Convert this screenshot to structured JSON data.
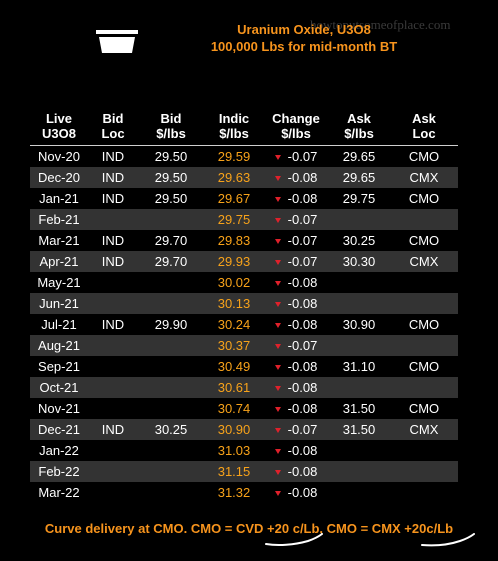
{
  "header": {
    "watermark": "howtoputsomeofplace.com",
    "title_line1": "Uranium Oxide, U3O8",
    "title_line2": "100,000 Lbs for mid-month BT"
  },
  "columns": [
    "Live\nU3O8",
    "Bid\nLoc",
    "Bid\n$/lbs",
    "Indic\n$/lbs",
    "Change\n$/lbs",
    "Ask\n$/lbs",
    "Ask\nLoc"
  ],
  "rows": [
    {
      "month": "Nov-20",
      "bid_loc": "IND",
      "bid": "29.50",
      "indic": "29.59",
      "change": "-0.07",
      "ask": "29.65",
      "ask_loc": "CMO"
    },
    {
      "month": "Dec-20",
      "bid_loc": "IND",
      "bid": "29.50",
      "indic": "29.63",
      "change": "-0.08",
      "ask": "29.65",
      "ask_loc": "CMX"
    },
    {
      "month": "Jan-21",
      "bid_loc": "IND",
      "bid": "29.50",
      "indic": "29.67",
      "change": "-0.08",
      "ask": "29.75",
      "ask_loc": "CMO"
    },
    {
      "month": "Feb-21",
      "bid_loc": "",
      "bid": "",
      "indic": "29.75",
      "change": "-0.07",
      "ask": "",
      "ask_loc": ""
    },
    {
      "month": "Mar-21",
      "bid_loc": "IND",
      "bid": "29.70",
      "indic": "29.83",
      "change": "-0.07",
      "ask": "30.25",
      "ask_loc": "CMO"
    },
    {
      "month": "Apr-21",
      "bid_loc": "IND",
      "bid": "29.70",
      "indic": "29.93",
      "change": "-0.07",
      "ask": "30.30",
      "ask_loc": "CMX"
    },
    {
      "month": "May-21",
      "bid_loc": "",
      "bid": "",
      "indic": "30.02",
      "change": "-0.08",
      "ask": "",
      "ask_loc": ""
    },
    {
      "month": "Jun-21",
      "bid_loc": "",
      "bid": "",
      "indic": "30.13",
      "change": "-0.08",
      "ask": "",
      "ask_loc": ""
    },
    {
      "month": "Jul-21",
      "bid_loc": "IND",
      "bid": "29.90",
      "indic": "30.24",
      "change": "-0.08",
      "ask": "30.90",
      "ask_loc": "CMO"
    },
    {
      "month": "Aug-21",
      "bid_loc": "",
      "bid": "",
      "indic": "30.37",
      "change": "-0.07",
      "ask": "",
      "ask_loc": ""
    },
    {
      "month": "Sep-21",
      "bid_loc": "",
      "bid": "",
      "indic": "30.49",
      "change": "-0.08",
      "ask": "31.10",
      "ask_loc": "CMO"
    },
    {
      "month": "Oct-21",
      "bid_loc": "",
      "bid": "",
      "indic": "30.61",
      "change": "-0.08",
      "ask": "",
      "ask_loc": ""
    },
    {
      "month": "Nov-21",
      "bid_loc": "",
      "bid": "",
      "indic": "30.74",
      "change": "-0.08",
      "ask": "31.50",
      "ask_loc": "CMO"
    },
    {
      "month": "Dec-21",
      "bid_loc": "IND",
      "bid": "30.25",
      "indic": "30.90",
      "change": "-0.07",
      "ask": "31.50",
      "ask_loc": "CMX"
    },
    {
      "month": "Jan-22",
      "bid_loc": "",
      "bid": "",
      "indic": "31.03",
      "change": "-0.08",
      "ask": "",
      "ask_loc": ""
    },
    {
      "month": "Feb-22",
      "bid_loc": "",
      "bid": "",
      "indic": "31.15",
      "change": "-0.08",
      "ask": "",
      "ask_loc": ""
    },
    {
      "month": "Mar-22",
      "bid_loc": "",
      "bid": "",
      "indic": "31.32",
      "change": "-0.08",
      "ask": "",
      "ask_loc": ""
    }
  ],
  "footer": {
    "note": "Curve delivery at CMO. CMO = CVD +20 c/Lb, CMO = CMX +20c/Lb"
  },
  "colors": {
    "background": "#000000",
    "accent_orange": "#f7941d",
    "indic_text": "#f7a21a",
    "stripe": "#333333",
    "down_arrow": "#e0212b",
    "handwritten_underline": "#ffffff"
  },
  "icons": {
    "logo": "logo-box-icon",
    "change": "down-triangle-icon"
  }
}
